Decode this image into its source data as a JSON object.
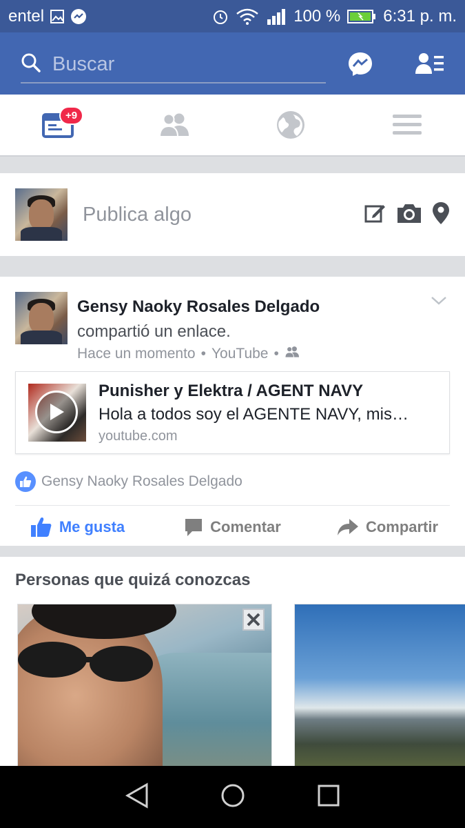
{
  "status_bar": {
    "carrier": "entel",
    "battery_text": "100 %",
    "time": "6:31 p. m.",
    "icons": [
      "image-icon",
      "messenger-notification-icon",
      "alarm-icon",
      "wifi-icon",
      "signal-icon",
      "battery-icon"
    ]
  },
  "search": {
    "placeholder": "Buscar"
  },
  "nav": {
    "tabs": [
      {
        "name": "news-feed",
        "icon": "news-feed-icon",
        "badge": "+9",
        "active": true
      },
      {
        "name": "friend-requests",
        "icon": "friends-icon"
      },
      {
        "name": "notifications",
        "icon": "globe-icon"
      },
      {
        "name": "menu",
        "icon": "hamburger-icon"
      }
    ]
  },
  "composer": {
    "placeholder": "Publica algo",
    "actions": [
      "edit-icon",
      "camera-icon",
      "location-pin-icon"
    ]
  },
  "post": {
    "author": "Gensy Naoky Rosales Delgado",
    "action": "compartió un enlace.",
    "time": "Hace un momento",
    "source": "YouTube",
    "privacy_icon": "friends-icon",
    "link": {
      "title": "Punisher y Elektra / AGENT NAVY",
      "description": "Hola a todos soy el AGENTE NAVY, mis…",
      "domain": "youtube.com"
    },
    "likes_text": "Gensy Naoky Rosales Delgado",
    "buttons": {
      "like": "Me gusta",
      "comment": "Comentar",
      "share": "Compartir"
    }
  },
  "pymk": {
    "title": "Personas que quizá conozcas"
  },
  "colors": {
    "brand": "#3b5998",
    "topbar": "#4267b2",
    "like_blue": "#4080ff",
    "badge_red": "#f02849"
  }
}
